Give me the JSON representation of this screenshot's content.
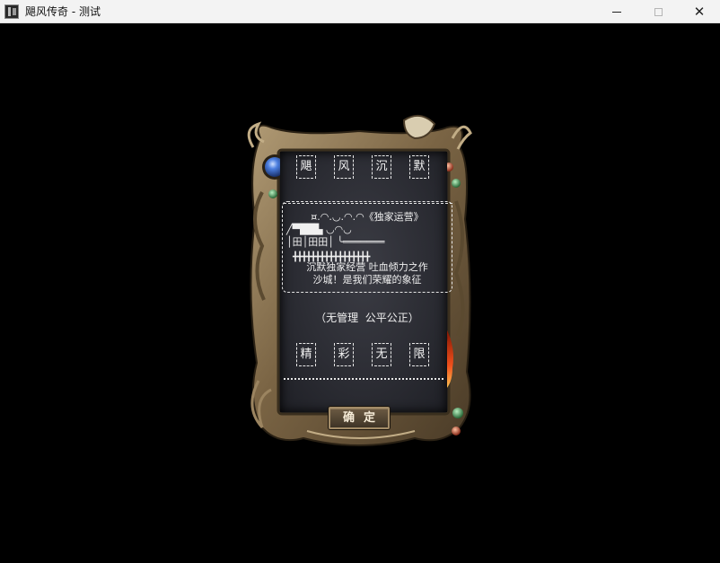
{
  "window": {
    "title": "飓风传奇 - 测试",
    "close_glyph": "✕"
  },
  "dialog": {
    "title_tiles": [
      "飓",
      "风",
      "沉",
      "默"
    ],
    "banner": {
      "line1": "¤.◠.◡.◠.◠《独家运营》",
      "line2": "╱▀██▙   ◡◠◡",
      "line3": "│田│田田│  ╰═══════",
      "plus_row": "╋╋╋╋╋╋╋╋╋╋╋╋╋╋╋╋╋",
      "line4": "沉默独家经营 吐血倾力之作",
      "line5": "沙城！是我们荣耀的象征"
    },
    "subtitle": "（无管理  公平公正）",
    "bottom_tiles": [
      "精",
      "彩",
      "无",
      "限"
    ],
    "confirm_label": "确定"
  },
  "colors": {
    "frame_bronze": "#8a7350",
    "gem_blue": "#3b6fd1",
    "flame": "#e0391a"
  }
}
